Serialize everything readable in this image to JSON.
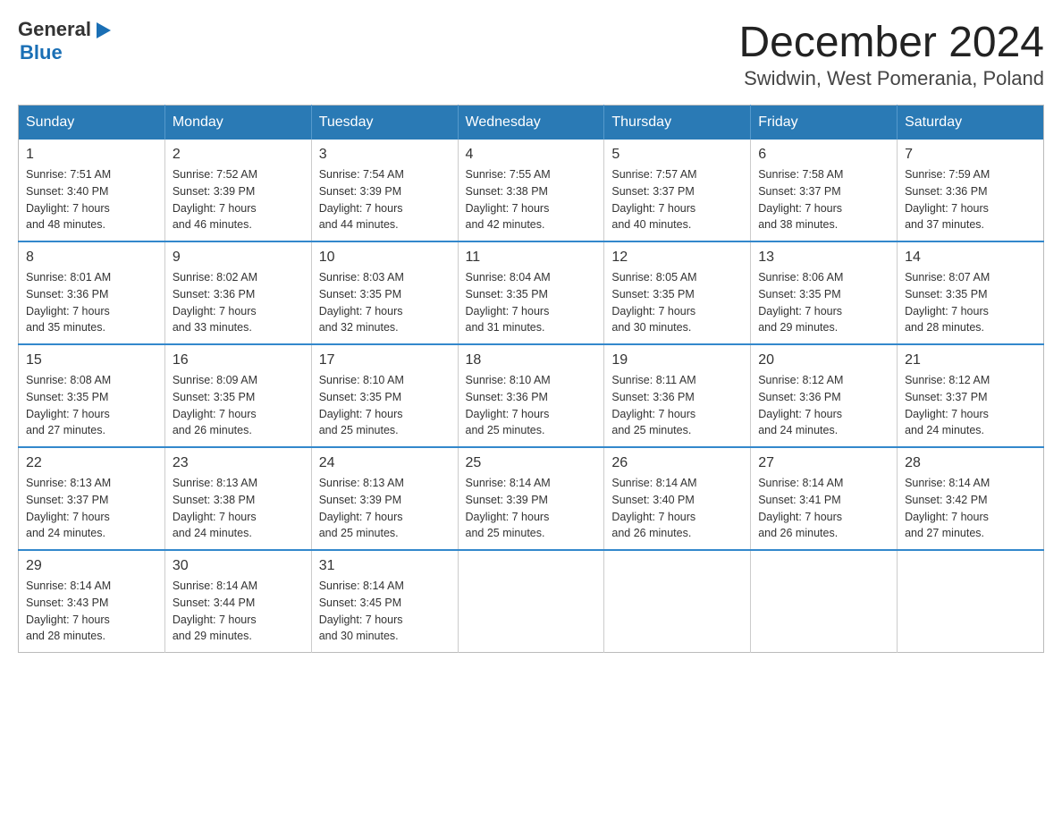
{
  "logo": {
    "text_general": "General",
    "triangle": "▶",
    "text_blue": "Blue"
  },
  "header": {
    "month": "December 2024",
    "location": "Swidwin, West Pomerania, Poland"
  },
  "days_of_week": [
    "Sunday",
    "Monday",
    "Tuesday",
    "Wednesday",
    "Thursday",
    "Friday",
    "Saturday"
  ],
  "weeks": [
    [
      {
        "day": "1",
        "sunrise": "7:51 AM",
        "sunset": "3:40 PM",
        "daylight": "7 hours and 48 minutes."
      },
      {
        "day": "2",
        "sunrise": "7:52 AM",
        "sunset": "3:39 PM",
        "daylight": "7 hours and 46 minutes."
      },
      {
        "day": "3",
        "sunrise": "7:54 AM",
        "sunset": "3:39 PM",
        "daylight": "7 hours and 44 minutes."
      },
      {
        "day": "4",
        "sunrise": "7:55 AM",
        "sunset": "3:38 PM",
        "daylight": "7 hours and 42 minutes."
      },
      {
        "day": "5",
        "sunrise": "7:57 AM",
        "sunset": "3:37 PM",
        "daylight": "7 hours and 40 minutes."
      },
      {
        "day": "6",
        "sunrise": "7:58 AM",
        "sunset": "3:37 PM",
        "daylight": "7 hours and 38 minutes."
      },
      {
        "day": "7",
        "sunrise": "7:59 AM",
        "sunset": "3:36 PM",
        "daylight": "7 hours and 37 minutes."
      }
    ],
    [
      {
        "day": "8",
        "sunrise": "8:01 AM",
        "sunset": "3:36 PM",
        "daylight": "7 hours and 35 minutes."
      },
      {
        "day": "9",
        "sunrise": "8:02 AM",
        "sunset": "3:36 PM",
        "daylight": "7 hours and 33 minutes."
      },
      {
        "day": "10",
        "sunrise": "8:03 AM",
        "sunset": "3:35 PM",
        "daylight": "7 hours and 32 minutes."
      },
      {
        "day": "11",
        "sunrise": "8:04 AM",
        "sunset": "3:35 PM",
        "daylight": "7 hours and 31 minutes."
      },
      {
        "day": "12",
        "sunrise": "8:05 AM",
        "sunset": "3:35 PM",
        "daylight": "7 hours and 30 minutes."
      },
      {
        "day": "13",
        "sunrise": "8:06 AM",
        "sunset": "3:35 PM",
        "daylight": "7 hours and 29 minutes."
      },
      {
        "day": "14",
        "sunrise": "8:07 AM",
        "sunset": "3:35 PM",
        "daylight": "7 hours and 28 minutes."
      }
    ],
    [
      {
        "day": "15",
        "sunrise": "8:08 AM",
        "sunset": "3:35 PM",
        "daylight": "7 hours and 27 minutes."
      },
      {
        "day": "16",
        "sunrise": "8:09 AM",
        "sunset": "3:35 PM",
        "daylight": "7 hours and 26 minutes."
      },
      {
        "day": "17",
        "sunrise": "8:10 AM",
        "sunset": "3:35 PM",
        "daylight": "7 hours and 25 minutes."
      },
      {
        "day": "18",
        "sunrise": "8:10 AM",
        "sunset": "3:36 PM",
        "daylight": "7 hours and 25 minutes."
      },
      {
        "day": "19",
        "sunrise": "8:11 AM",
        "sunset": "3:36 PM",
        "daylight": "7 hours and 25 minutes."
      },
      {
        "day": "20",
        "sunrise": "8:12 AM",
        "sunset": "3:36 PM",
        "daylight": "7 hours and 24 minutes."
      },
      {
        "day": "21",
        "sunrise": "8:12 AM",
        "sunset": "3:37 PM",
        "daylight": "7 hours and 24 minutes."
      }
    ],
    [
      {
        "day": "22",
        "sunrise": "8:13 AM",
        "sunset": "3:37 PM",
        "daylight": "7 hours and 24 minutes."
      },
      {
        "day": "23",
        "sunrise": "8:13 AM",
        "sunset": "3:38 PM",
        "daylight": "7 hours and 24 minutes."
      },
      {
        "day": "24",
        "sunrise": "8:13 AM",
        "sunset": "3:39 PM",
        "daylight": "7 hours and 25 minutes."
      },
      {
        "day": "25",
        "sunrise": "8:14 AM",
        "sunset": "3:39 PM",
        "daylight": "7 hours and 25 minutes."
      },
      {
        "day": "26",
        "sunrise": "8:14 AM",
        "sunset": "3:40 PM",
        "daylight": "7 hours and 26 minutes."
      },
      {
        "day": "27",
        "sunrise": "8:14 AM",
        "sunset": "3:41 PM",
        "daylight": "7 hours and 26 minutes."
      },
      {
        "day": "28",
        "sunrise": "8:14 AM",
        "sunset": "3:42 PM",
        "daylight": "7 hours and 27 minutes."
      }
    ],
    [
      {
        "day": "29",
        "sunrise": "8:14 AM",
        "sunset": "3:43 PM",
        "daylight": "7 hours and 28 minutes."
      },
      {
        "day": "30",
        "sunrise": "8:14 AM",
        "sunset": "3:44 PM",
        "daylight": "7 hours and 29 minutes."
      },
      {
        "day": "31",
        "sunrise": "8:14 AM",
        "sunset": "3:45 PM",
        "daylight": "7 hours and 30 minutes."
      },
      null,
      null,
      null,
      null
    ]
  ],
  "labels": {
    "sunrise": "Sunrise: ",
    "sunset": "Sunset: ",
    "daylight": "Daylight: "
  }
}
